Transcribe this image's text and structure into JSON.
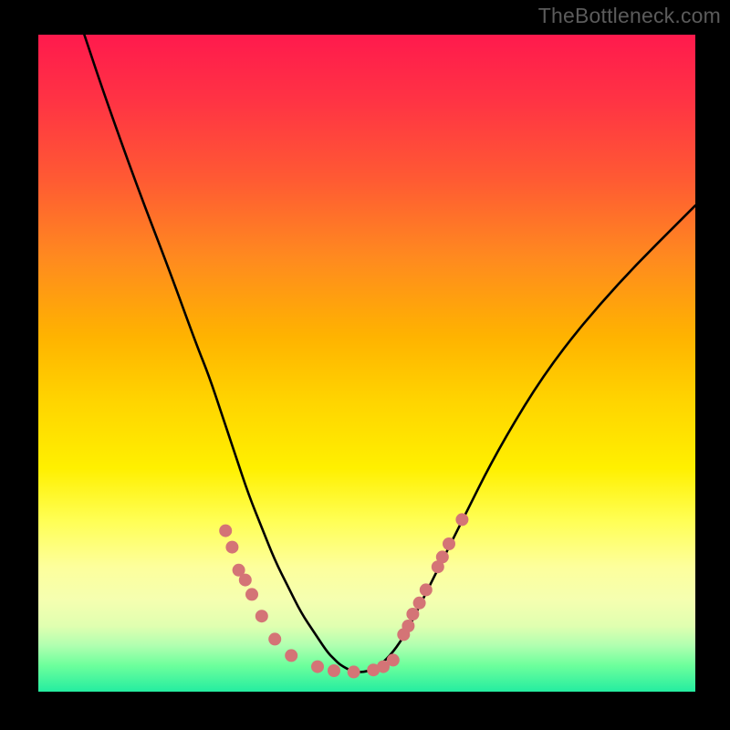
{
  "watermark": "TheBottleneck.com",
  "chart_data": {
    "type": "line",
    "title": "",
    "xlabel": "",
    "ylabel": "",
    "xlim": [
      0,
      100
    ],
    "ylim": [
      0,
      100
    ],
    "series": [
      {
        "name": "curve",
        "x": [
          7,
          10,
          15,
          20,
          24,
          26,
          28,
          30,
          32,
          34,
          36,
          38,
          40,
          42,
          44,
          45,
          46,
          48,
          50,
          52,
          54,
          56,
          58,
          60,
          64,
          70,
          78,
          88,
          100
        ],
        "y": [
          100,
          91,
          77,
          64,
          53,
          48,
          42,
          36,
          30,
          25,
          20,
          16,
          12,
          9,
          6,
          5,
          4,
          3,
          3,
          4,
          6,
          9,
          13,
          17,
          25,
          37,
          50,
          62,
          74
        ]
      }
    ],
    "markers": {
      "color": "#d47476",
      "radius_px": 7,
      "points_xy": [
        [
          28.5,
          24.5
        ],
        [
          29.5,
          22.0
        ],
        [
          30.5,
          18.5
        ],
        [
          31.5,
          17.0
        ],
        [
          32.5,
          14.8
        ],
        [
          34.0,
          11.5
        ],
        [
          36.0,
          8.0
        ],
        [
          38.5,
          5.5
        ],
        [
          42.5,
          3.8
        ],
        [
          45.0,
          3.2
        ],
        [
          48.0,
          3.0
        ],
        [
          51.0,
          3.3
        ],
        [
          52.5,
          3.8
        ],
        [
          54.0,
          4.8
        ],
        [
          55.6,
          8.7
        ],
        [
          57.0,
          11.8
        ],
        [
          56.3,
          10.0
        ],
        [
          58.0,
          13.5
        ],
        [
          59.0,
          15.5
        ],
        [
          60.8,
          19.0
        ],
        [
          61.5,
          20.5
        ],
        [
          62.5,
          22.5
        ],
        [
          64.5,
          26.2
        ]
      ]
    },
    "gradient_stops": [
      {
        "pos": 0,
        "color": "#ff1a4d"
      },
      {
        "pos": 66,
        "color": "#fff000"
      },
      {
        "pos": 100,
        "color": "#24eda0"
      }
    ]
  }
}
